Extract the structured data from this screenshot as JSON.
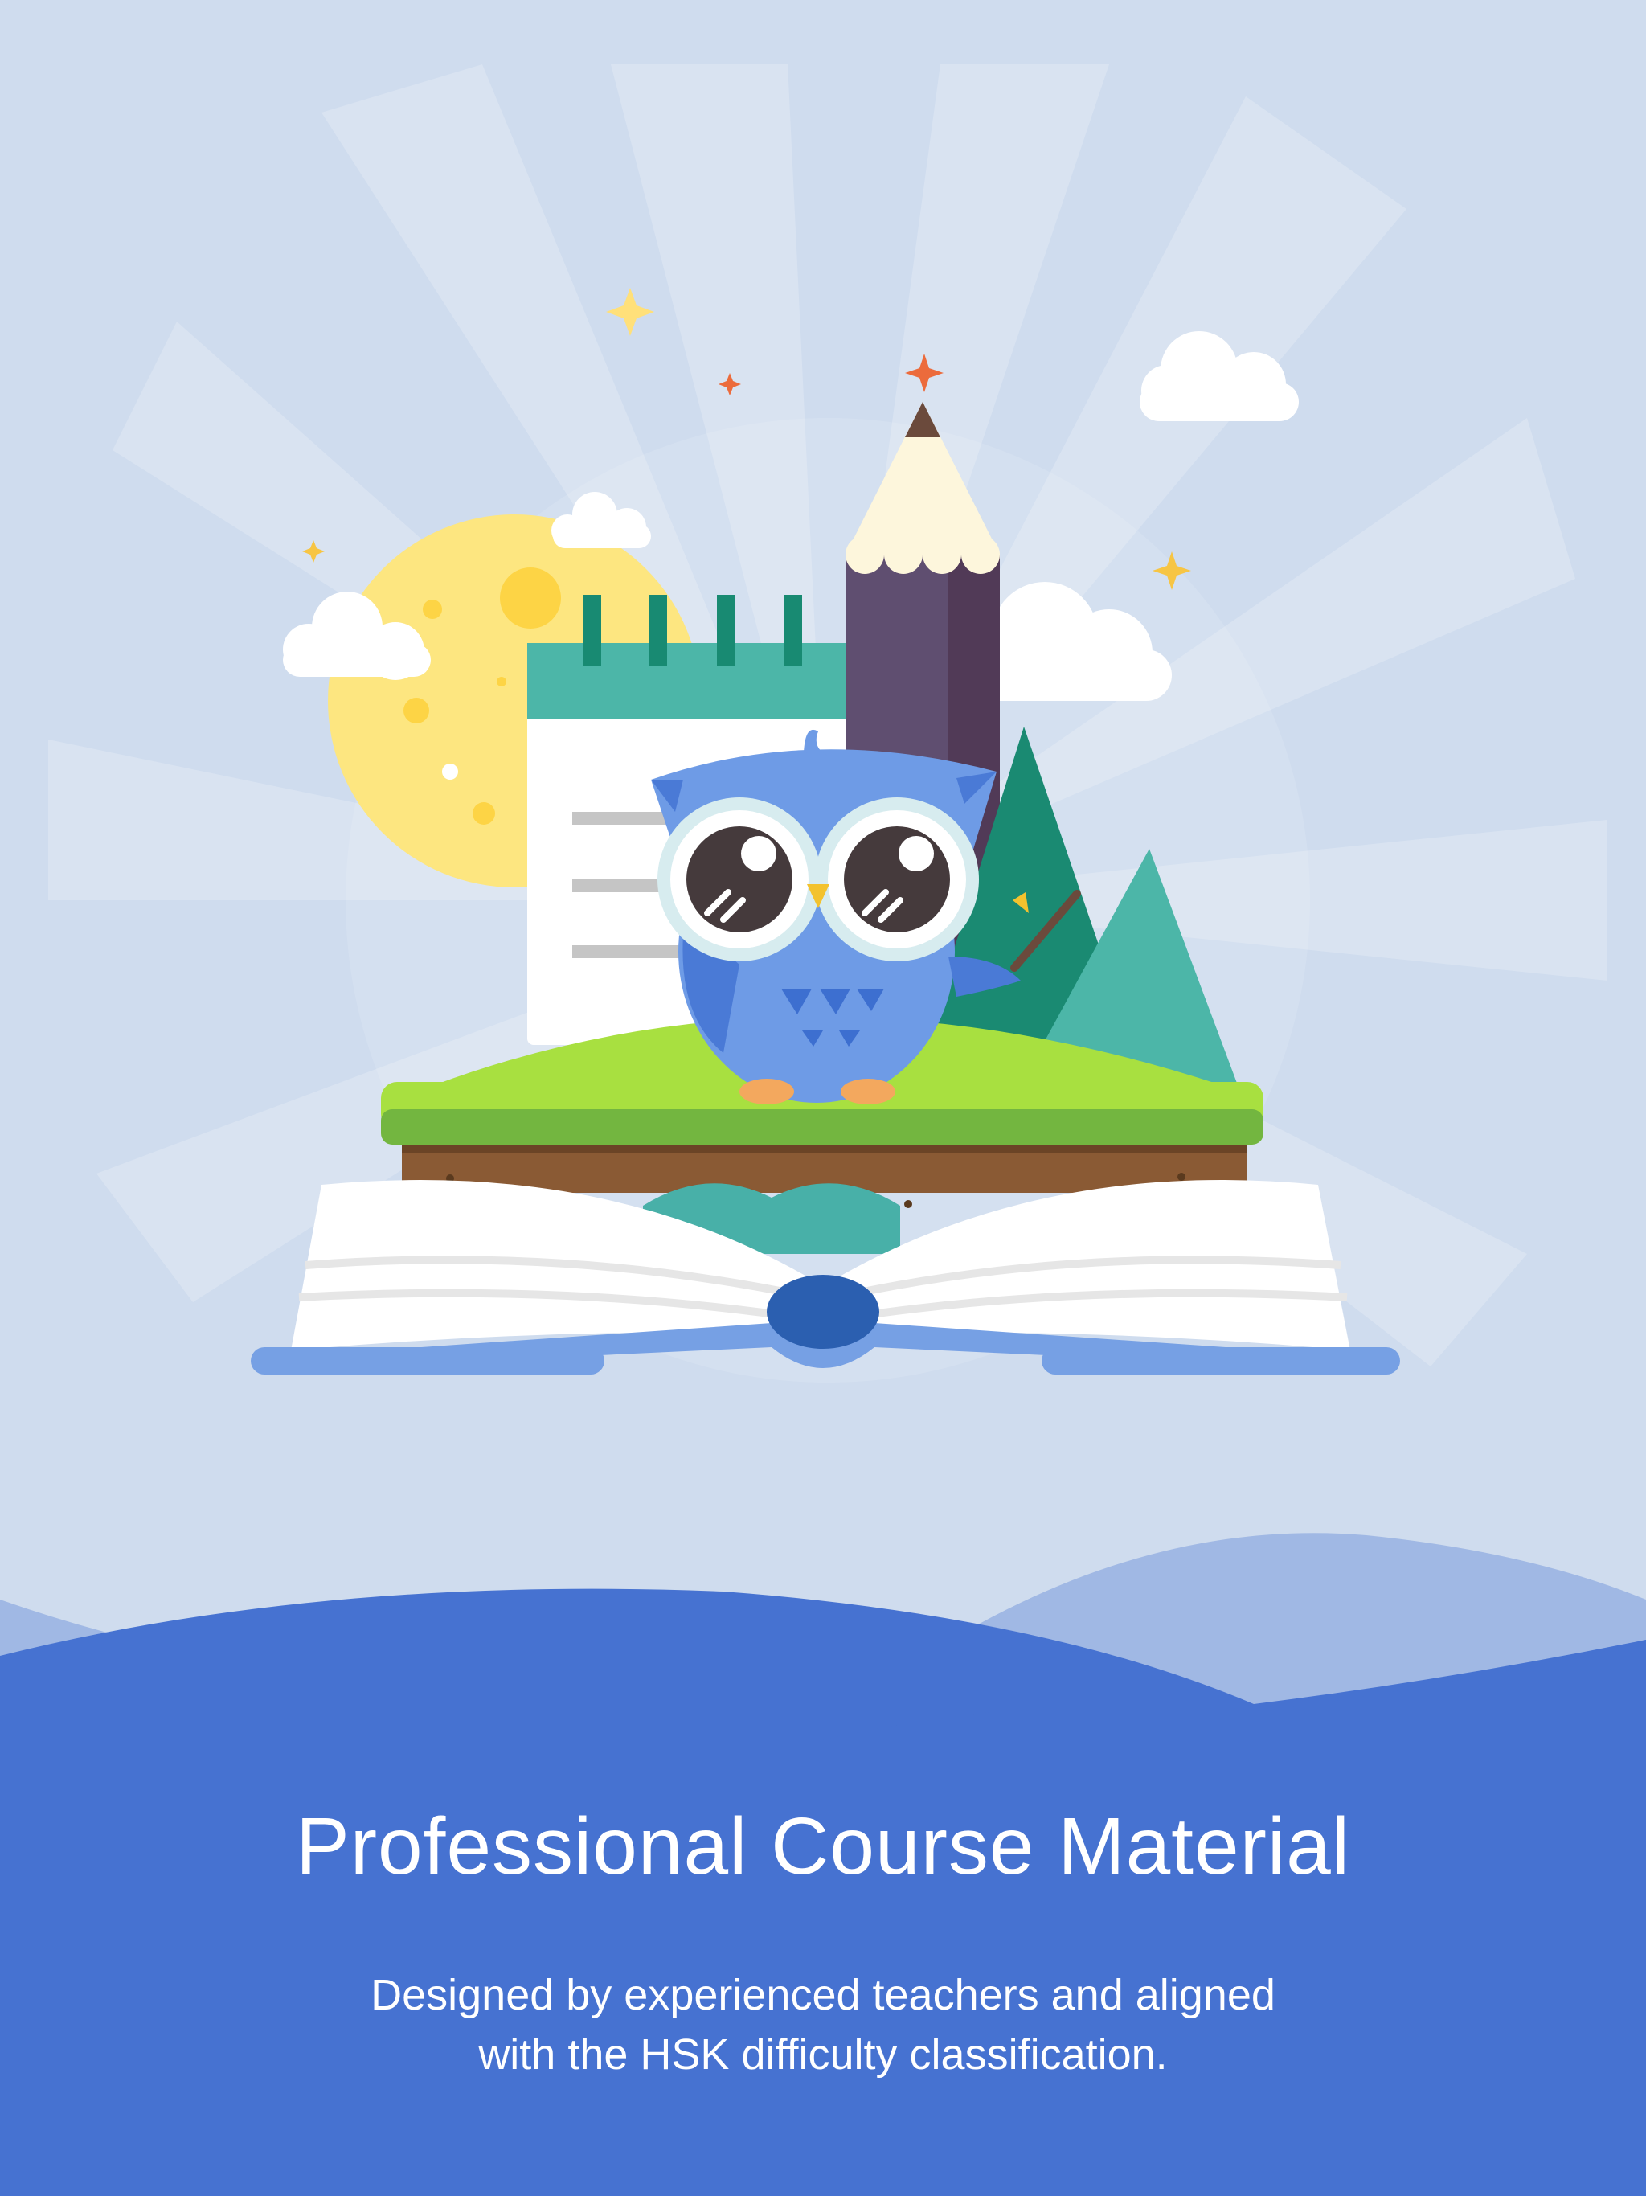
{
  "onboarding": {
    "title": "Professional Course Material",
    "subtitle_lines": [
      "Designed by experienced teachers and aligned",
      "with the HSK difficulty classification."
    ]
  },
  "illustration": {
    "elements": [
      "sun",
      "calendar-notepad",
      "pencil",
      "owl-mascot",
      "mountains",
      "open-book",
      "clouds",
      "sparkles"
    ]
  },
  "colors": {
    "sky": "#cfdcee",
    "wave_light": "#a0b8e4",
    "wave_dark": "#4672d1",
    "text": "#ffffff"
  }
}
